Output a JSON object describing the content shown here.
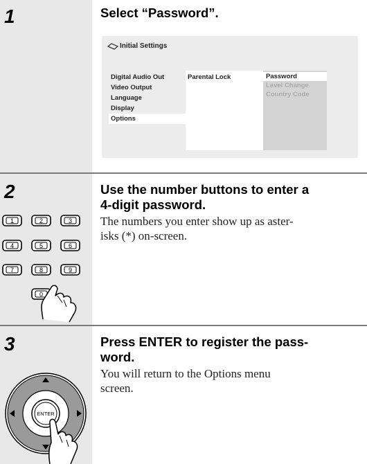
{
  "steps": [
    {
      "number": "1",
      "title": "Select “Password”."
    },
    {
      "number": "2",
      "title_line1": "Use the number buttons to enter a",
      "title_line2": "4-digit password.",
      "body_line1": "The numbers you enter show up as aster-",
      "body_line2": "isks (*) on-screen."
    },
    {
      "number": "3",
      "title_line1": "Press ENTER to register the pass-",
      "title_line2": "word.",
      "body_line1": "You will return to the Options menu",
      "body_line2": "screen."
    }
  ],
  "screen": {
    "title": "Initial Settings",
    "menu": [
      "Digital Audio Out",
      "Video Output",
      "Language",
      "Display",
      "Options"
    ],
    "submenu": [
      "Parental Lock"
    ],
    "options": [
      "Password",
      "Level Change",
      "Country Code"
    ]
  },
  "keypad": {
    "keys": [
      "1",
      "2",
      "3",
      "4",
      "5",
      "6",
      "7",
      "8",
      "9",
      "0"
    ]
  },
  "remote": {
    "center_label": "ENTER"
  }
}
